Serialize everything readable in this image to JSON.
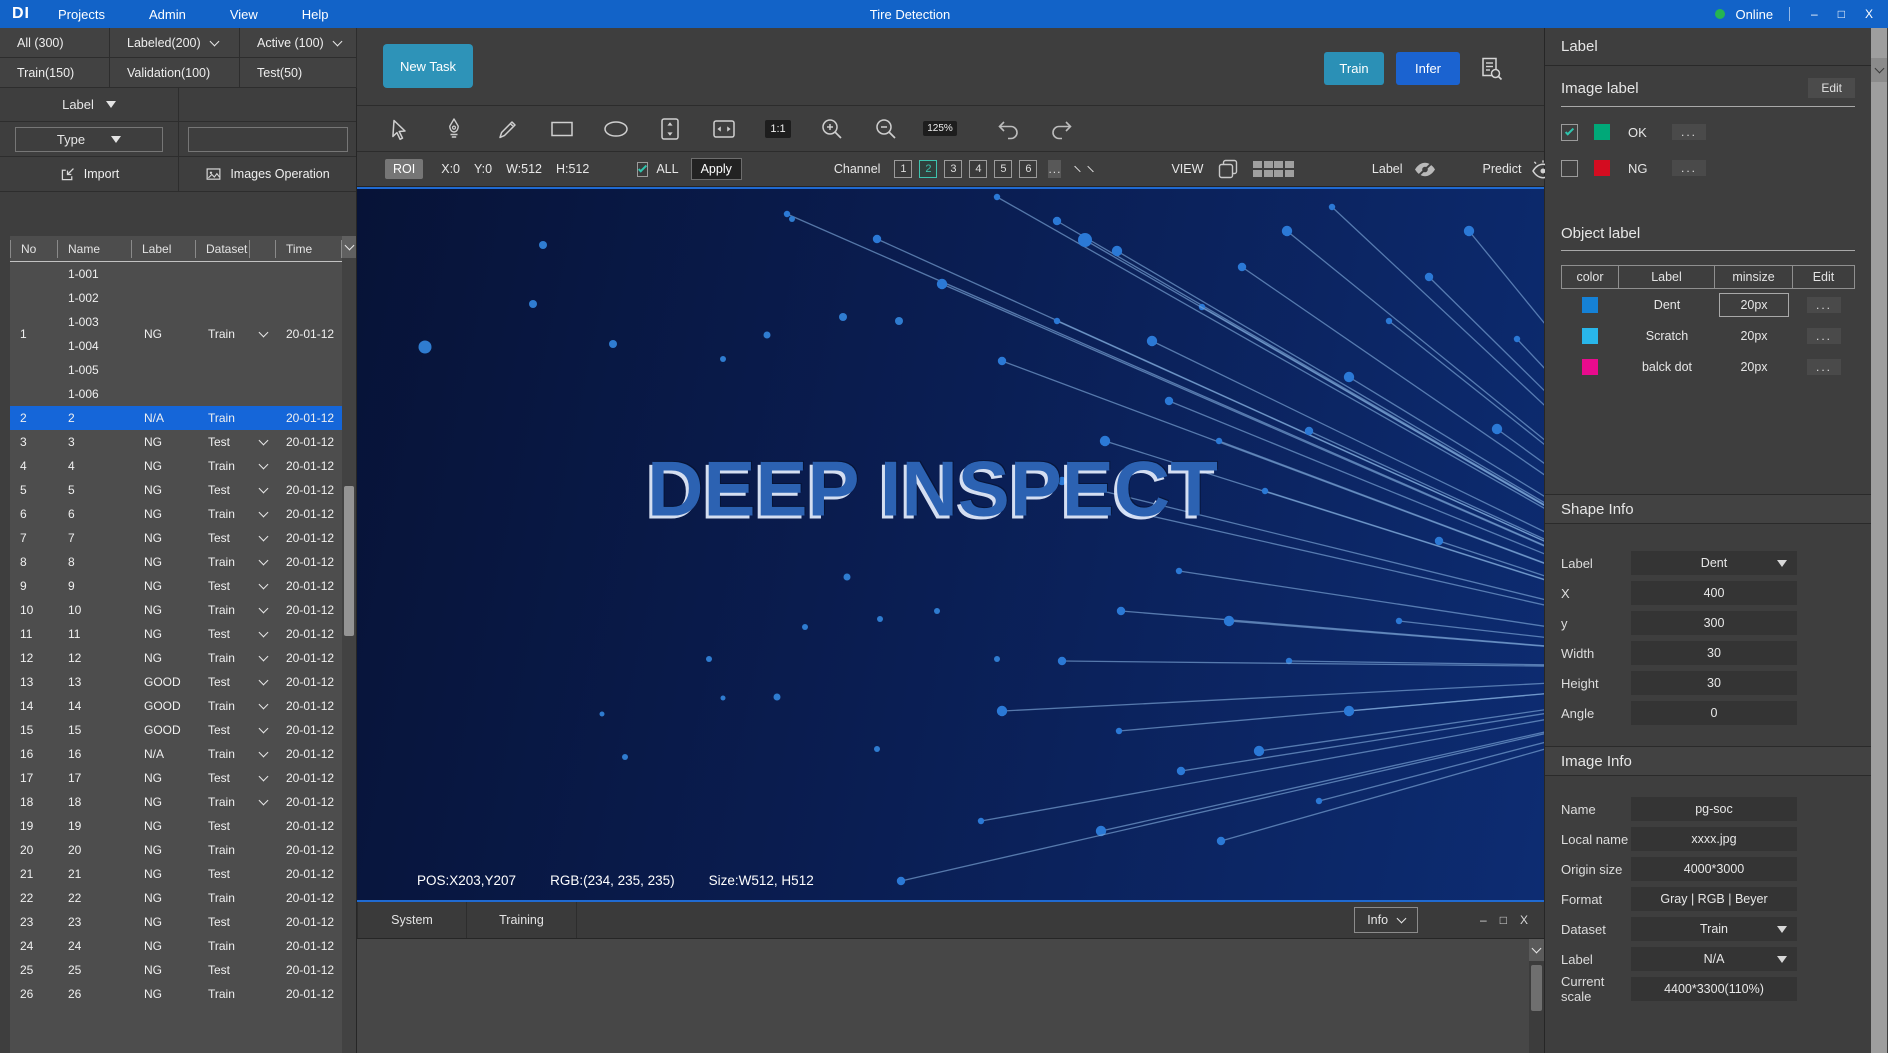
{
  "window_controls": {
    "min": "–",
    "max": "□",
    "close": "X"
  },
  "topbar": {
    "logo": "DI",
    "menus": [
      "Projects",
      "Admin",
      "View",
      "Help"
    ],
    "title": "Tire Detection",
    "status": "Online"
  },
  "left": {
    "filters": [
      {
        "label": "All (300)",
        "chevron": false
      },
      {
        "label": "Labeled(200)",
        "chevron": true
      },
      {
        "label": "Active (100)",
        "chevron": true
      },
      {
        "label": "Train(150)",
        "chevron": false
      },
      {
        "label": "Validation(100)",
        "chevron": false
      },
      {
        "label": "Test(50)",
        "chevron": false
      }
    ],
    "label_dropdown": "Label",
    "type_dropdown": "Type",
    "search_placeholder": "",
    "import_label": "Import",
    "images_operation_label": "Images Operation",
    "table": {
      "headers": [
        "No",
        "Name",
        "Label",
        "Dataset",
        "Time"
      ],
      "group": {
        "no": "1",
        "names": [
          "1-001",
          "1-002",
          "1-003",
          "1-004",
          "1-005",
          "1-006"
        ],
        "label": "NG",
        "dataset": "Train",
        "chevron": true,
        "time": "20-01-12"
      },
      "rows": [
        {
          "no": "2",
          "name": "2",
          "label": "N/A",
          "dataset": "Train",
          "chevron": false,
          "time": "20-01-12",
          "selected": true
        },
        {
          "no": "3",
          "name": "3",
          "label": "NG",
          "dataset": "Test",
          "chevron": true,
          "time": "20-01-12",
          "selected": false
        },
        {
          "no": "4",
          "name": "4",
          "label": "NG",
          "dataset": "Train",
          "chevron": true,
          "time": "20-01-12",
          "selected": false
        },
        {
          "no": "5",
          "name": "5",
          "label": "NG",
          "dataset": "Test",
          "chevron": true,
          "time": "20-01-12",
          "selected": false
        },
        {
          "no": "6",
          "name": "6",
          "label": "NG",
          "dataset": "Train",
          "chevron": true,
          "time": "20-01-12",
          "selected": false
        },
        {
          "no": "7",
          "name": "7",
          "label": "NG",
          "dataset": "Test",
          "chevron": true,
          "time": "20-01-12",
          "selected": false
        },
        {
          "no": "8",
          "name": "8",
          "label": "NG",
          "dataset": "Train",
          "chevron": true,
          "time": "20-01-12",
          "selected": false
        },
        {
          "no": "9",
          "name": "9",
          "label": "NG",
          "dataset": "Test",
          "chevron": true,
          "time": "20-01-12",
          "selected": false
        },
        {
          "no": "10",
          "name": "10",
          "label": "NG",
          "dataset": "Train",
          "chevron": true,
          "time": "20-01-12",
          "selected": false
        },
        {
          "no": "11",
          "name": "11",
          "label": "NG",
          "dataset": "Test",
          "chevron": true,
          "time": "20-01-12",
          "selected": false
        },
        {
          "no": "12",
          "name": "12",
          "label": "NG",
          "dataset": "Train",
          "chevron": true,
          "time": "20-01-12",
          "selected": false
        },
        {
          "no": "13",
          "name": "13",
          "label": "GOOD",
          "dataset": "Test",
          "chevron": true,
          "time": "20-01-12",
          "selected": false
        },
        {
          "no": "14",
          "name": "14",
          "label": "GOOD",
          "dataset": "Train",
          "chevron": true,
          "time": "20-01-12",
          "selected": false
        },
        {
          "no": "15",
          "name": "15",
          "label": "GOOD",
          "dataset": "Test",
          "chevron": true,
          "time": "20-01-12",
          "selected": false
        },
        {
          "no": "16",
          "name": "16",
          "label": "N/A",
          "dataset": "Train",
          "chevron": true,
          "time": "20-01-12",
          "selected": false
        },
        {
          "no": "17",
          "name": "17",
          "label": "NG",
          "dataset": "Test",
          "chevron": true,
          "time": "20-01-12",
          "selected": false
        },
        {
          "no": "18",
          "name": "18",
          "label": "NG",
          "dataset": "Train",
          "chevron": true,
          "time": "20-01-12",
          "selected": false
        },
        {
          "no": "19",
          "name": "19",
          "label": "NG",
          "dataset": "Test",
          "chevron": false,
          "time": "20-01-12",
          "selected": false
        },
        {
          "no": "20",
          "name": "20",
          "label": "NG",
          "dataset": "Train",
          "chevron": false,
          "time": "20-01-12",
          "selected": false
        },
        {
          "no": "21",
          "name": "21",
          "label": "NG",
          "dataset": "Test",
          "chevron": false,
          "time": "20-01-12",
          "selected": false
        },
        {
          "no": "22",
          "name": "22",
          "label": "NG",
          "dataset": "Train",
          "chevron": false,
          "time": "20-01-12",
          "selected": false
        },
        {
          "no": "23",
          "name": "23",
          "label": "NG",
          "dataset": "Test",
          "chevron": false,
          "time": "20-01-12",
          "selected": false
        },
        {
          "no": "24",
          "name": "24",
          "label": "NG",
          "dataset": "Train",
          "chevron": false,
          "time": "20-01-12",
          "selected": false
        },
        {
          "no": "25",
          "name": "25",
          "label": "NG",
          "dataset": "Test",
          "chevron": false,
          "time": "20-01-12",
          "selected": false
        },
        {
          "no": "26",
          "name": "26",
          "label": "NG",
          "dataset": "Train",
          "chevron": false,
          "time": "20-01-12",
          "selected": false
        }
      ]
    }
  },
  "actions": {
    "new_task": "New Task",
    "train": "Train",
    "infer": "Infer"
  },
  "toolbar": {
    "one_to_one": "1:1",
    "zoom_level": "125%"
  },
  "roibar": {
    "roi": "ROI",
    "x": "X:0",
    "y": "Y:0",
    "w": "W:512",
    "h": "H:512",
    "all": "ALL",
    "apply": "Apply",
    "channel": "Channel",
    "channels": [
      "1",
      "2",
      "3",
      "4",
      "5",
      "6"
    ],
    "active_channel": "2",
    "more": "...",
    "view": "VIEW",
    "label_toggle": "Label",
    "predict_toggle": "Predict"
  },
  "viewer": {
    "watermark": "DEEP INSPECT",
    "pos": "POS:X203,Y207",
    "rgb": "RGB:(234, 235, 235)",
    "size": "Size:W512, H512"
  },
  "console": {
    "tabs": [
      "System",
      "Training"
    ],
    "info": "Info"
  },
  "right": {
    "title": "Label",
    "image_label": {
      "title": "Image label",
      "edit": "Edit",
      "rows": [
        {
          "checked": true,
          "color": "#00a878",
          "label": "OK"
        },
        {
          "checked": false,
          "color": "#d40c20",
          "label": "NG"
        }
      ]
    },
    "object_label": {
      "title": "Object label",
      "headers": [
        "color",
        "Label",
        "minsize",
        "Edit"
      ],
      "rows": [
        {
          "color": "#1581d6",
          "label": "Dent",
          "minsize": "20px",
          "focused": true
        },
        {
          "color": "#29b6ea",
          "label": "Scratch",
          "minsize": "20px",
          "focused": false
        },
        {
          "color": "#e80b8d",
          "label": "balck dot",
          "minsize": "20px",
          "focused": false
        }
      ]
    },
    "shape_info": {
      "title": "Shape Info",
      "fields": [
        {
          "label": "Label",
          "value": "Dent",
          "select": true
        },
        {
          "label": "X",
          "value": "400",
          "select": false
        },
        {
          "label": "y",
          "value": "300",
          "select": false
        },
        {
          "label": "Width",
          "value": "30",
          "select": false
        },
        {
          "label": "Height",
          "value": "30",
          "select": false
        },
        {
          "label": "Angle",
          "value": "0",
          "select": false
        }
      ]
    },
    "image_info": {
      "title": "Image Info",
      "fields": [
        {
          "label": "Name",
          "value": "pg-soc",
          "select": false
        },
        {
          "label": "Local name",
          "value": "xxxx.jpg",
          "select": false
        },
        {
          "label": "Origin size",
          "value": "4000*3000",
          "select": false
        },
        {
          "label": "Format",
          "value": "Gray | RGB | Beyer",
          "select": false
        },
        {
          "label": "Dataset",
          "value": "Train",
          "select": true
        },
        {
          "label": "Label",
          "value": "N/A",
          "select": true
        },
        {
          "label": "Current scale",
          "value": "4400*3300(110%)",
          "select": false
        }
      ]
    }
  },
  "colors": {
    "topbar_blue": "#1263c8",
    "teal_button": "#2e93b8",
    "infer_blue": "#1b63d0",
    "selected_row": "#1566d9",
    "check_teal": "#2ec4ad",
    "channel_active": "#3ec3ae",
    "online_green": "#25b551",
    "viewer_navy": "#0a1d51",
    "watermark_blue": "#2c62b2"
  }
}
